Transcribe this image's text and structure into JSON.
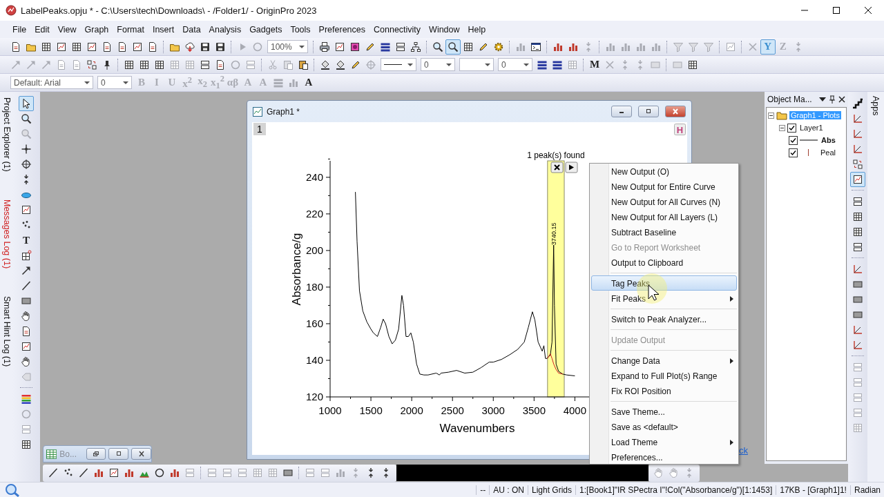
{
  "window": {
    "title": "LabelPeaks.opju * - C:\\Users\\tech\\Downloads\\ - /Folder1/ - OriginPro 2023"
  },
  "menu_bar": [
    "File",
    "Edit",
    "View",
    "Graph",
    "Format",
    "Insert",
    "Data",
    "Analysis",
    "Gadgets",
    "Tools",
    "Preferences",
    "Connectivity",
    "Window",
    "Help"
  ],
  "toolbars": [
    {
      "items": [
        {
          "kind": "icon",
          "disabled": false,
          "on": false
        },
        {
          "kind": "icon",
          "disabled": false,
          "on": false
        },
        {
          "kind": "icon",
          "disabled": false,
          "on": false
        },
        {
          "kind": "icon",
          "disabled": false,
          "on": false
        },
        {
          "kind": "icon",
          "disabled": false,
          "on": false
        },
        {
          "kind": "icon",
          "disabled": false,
          "on": false
        },
        {
          "kind": "icon",
          "disabled": false,
          "on": false
        },
        {
          "kind": "icon",
          "disabled": false,
          "on": false
        },
        {
          "kind": "icon",
          "disabled": false,
          "on": false
        },
        {
          "kind": "icon",
          "disabled": false,
          "on": false
        },
        {
          "kind": "separator"
        },
        {
          "kind": "icon",
          "disabled": false,
          "on": false
        },
        {
          "kind": "icon",
          "disabled": false,
          "on": false
        },
        {
          "kind": "icon",
          "disabled": false,
          "on": false
        },
        {
          "kind": "icon",
          "disabled": false,
          "on": false
        },
        {
          "kind": "separator"
        },
        {
          "kind": "icon",
          "disabled": true,
          "on": false
        },
        {
          "kind": "icon",
          "disabled": true,
          "on": false
        },
        {
          "kind": "combo",
          "value": "100%"
        },
        {
          "kind": "separator"
        },
        {
          "kind": "icon",
          "disabled": false,
          "on": false
        },
        {
          "kind": "icon",
          "disabled": false,
          "on": false
        },
        {
          "kind": "icon",
          "disabled": false,
          "on": false
        },
        {
          "kind": "icon",
          "disabled": false,
          "on": false
        },
        {
          "kind": "icon",
          "disabled": false,
          "on": false
        },
        {
          "kind": "icon",
          "disabled": false,
          "on": false
        },
        {
          "kind": "icon",
          "disabled": false,
          "on": false
        },
        {
          "kind": "separator"
        },
        {
          "kind": "icon",
          "disabled": false,
          "on": false
        },
        {
          "kind": "icon",
          "disabled": false,
          "on": true
        },
        {
          "kind": "icon",
          "disabled": false,
          "on": false
        },
        {
          "kind": "icon",
          "disabled": false,
          "on": false
        },
        {
          "kind": "icon",
          "disabled": false,
          "on": false
        },
        {
          "kind": "separator"
        },
        {
          "kind": "icon",
          "disabled": true,
          "on": false
        },
        {
          "kind": "icon",
          "disabled": false,
          "on": false
        },
        {
          "kind": "separator"
        },
        {
          "kind": "icon",
          "disabled": false,
          "on": false
        },
        {
          "kind": "icon",
          "disabled": false,
          "on": false
        },
        {
          "kind": "icon",
          "disabled": true,
          "on": false
        },
        {
          "kind": "separator"
        },
        {
          "kind": "icon",
          "disabled": true,
          "on": false
        },
        {
          "kind": "icon",
          "disabled": true,
          "on": false
        },
        {
          "kind": "icon",
          "disabled": true,
          "on": false
        },
        {
          "kind": "icon",
          "disabled": true,
          "on": false
        },
        {
          "kind": "separator"
        },
        {
          "kind": "icon",
          "disabled": true,
          "on": false
        },
        {
          "kind": "icon",
          "disabled": true,
          "on": false
        },
        {
          "kind": "icon",
          "disabled": true,
          "on": false
        },
        {
          "kind": "separator"
        },
        {
          "kind": "icon",
          "disabled": true,
          "on": false
        },
        {
          "kind": "separator"
        },
        {
          "kind": "icon",
          "disabled": true,
          "on": false
        },
        {
          "kind": "glyph",
          "text": "Y",
          "disabled": false,
          "on": true
        },
        {
          "kind": "glyph",
          "text": "Z",
          "disabled": true,
          "on": false
        },
        {
          "kind": "icon",
          "disabled": true,
          "on": false
        }
      ]
    },
    {
      "items": [
        {
          "kind": "icon",
          "disabled": true,
          "on": false
        },
        {
          "kind": "icon",
          "disabled": true,
          "on": false
        },
        {
          "kind": "icon",
          "disabled": true,
          "on": false
        },
        {
          "kind": "icon",
          "disabled": true,
          "on": false
        },
        {
          "kind": "icon",
          "disabled": true,
          "on": false
        },
        {
          "kind": "icon",
          "disabled": false,
          "on": false
        },
        {
          "kind": "icon",
          "disabled": false,
          "on": false
        },
        {
          "kind": "separator"
        },
        {
          "kind": "icon",
          "disabled": false,
          "on": false
        },
        {
          "kind": "icon",
          "disabled": false,
          "on": false
        },
        {
          "kind": "icon",
          "disabled": false,
          "on": false
        },
        {
          "kind": "icon",
          "disabled": true,
          "on": false
        },
        {
          "kind": "icon",
          "disabled": true,
          "on": false
        },
        {
          "kind": "icon",
          "disabled": false,
          "on": false
        },
        {
          "kind": "icon",
          "disabled": false,
          "on": false
        },
        {
          "kind": "icon",
          "disabled": true,
          "on": false
        },
        {
          "kind": "icon",
          "disabled": true,
          "on": false
        },
        {
          "kind": "separator"
        },
        {
          "kind": "icon",
          "disabled": true,
          "on": false
        },
        {
          "kind": "icon",
          "disabled": true,
          "on": false
        },
        {
          "kind": "icon",
          "disabled": false,
          "on": false
        },
        {
          "kind": "separator"
        },
        {
          "kind": "icon",
          "disabled": false,
          "on": false
        },
        {
          "kind": "icon",
          "disabled": false,
          "on": false
        },
        {
          "kind": "icon",
          "disabled": false,
          "on": false
        },
        {
          "kind": "icon",
          "disabled": true,
          "on": false
        },
        {
          "kind": "line-combo"
        },
        {
          "kind": "combo",
          "value": "0"
        },
        {
          "kind": "combo"
        },
        {
          "kind": "combo",
          "value": "0"
        },
        {
          "kind": "icon",
          "disabled": false,
          "on": false
        },
        {
          "kind": "icon",
          "disabled": false,
          "on": false
        },
        {
          "kind": "icon",
          "disabled": true,
          "on": false
        },
        {
          "kind": "separator"
        },
        {
          "kind": "glyph",
          "text": "M",
          "disabled": false,
          "on": false
        },
        {
          "kind": "icon",
          "disabled": true,
          "on": false
        },
        {
          "kind": "icon",
          "disabled": true,
          "on": false
        },
        {
          "kind": "icon",
          "disabled": true,
          "on": false
        },
        {
          "kind": "icon",
          "disabled": true,
          "on": false
        },
        {
          "kind": "separator"
        },
        {
          "kind": "icon",
          "disabled": true,
          "on": false
        },
        {
          "kind": "icon",
          "disabled": false,
          "on": false
        }
      ]
    },
    {
      "items": [
        {
          "kind": "font-combo",
          "value": "Default: Arial"
        },
        {
          "kind": "combo",
          "value": "0"
        },
        {
          "kind": "glyph",
          "text": "B",
          "disabled": true,
          "on": false
        },
        {
          "kind": "glyph",
          "text": "I",
          "disabled": true,
          "on": false
        },
        {
          "kind": "glyph",
          "text": "U",
          "disabled": true,
          "on": false
        },
        {
          "kind": "glyph",
          "text": "x$^{2}$",
          "disabled": true,
          "on": false
        },
        {
          "kind": "glyph",
          "text": "x$_{2}$",
          "disabled": true,
          "on": false
        },
        {
          "kind": "glyph",
          "text": "x$_{1}$$^{2}$",
          "disabled": true,
          "on": false
        },
        {
          "kind": "glyph",
          "text": "αβ",
          "disabled": true,
          "on": false
        },
        {
          "kind": "glyph",
          "text": "A",
          "disabled": true,
          "on": false
        },
        {
          "kind": "glyph",
          "text": "A",
          "disabled": true,
          "on": false
        },
        {
          "kind": "icon",
          "disabled": true,
          "on": false
        },
        {
          "kind": "icon",
          "disabled": true,
          "on": false
        },
        {
          "kind": "glyph",
          "text": "A",
          "disabled": false,
          "on": false
        }
      ]
    }
  ],
  "side_tabs": [
    {
      "label": "Project Explorer (1)",
      "alert": false
    },
    {
      "label": "Messages Log (1)",
      "alert": true
    },
    {
      "label": "Smart Hint Log (1)",
      "alert": false
    }
  ],
  "tools_toolbar": {
    "items": [
      {
        "kind": "icon",
        "disabled": false,
        "on": true
      },
      {
        "kind": "icon",
        "disabled": false,
        "on": false
      },
      {
        "kind": "icon",
        "disabled": true,
        "on": false
      },
      {
        "kind": "icon",
        "disabled": false,
        "on": false
      },
      {
        "kind": "icon",
        "disabled": false,
        "on": false
      },
      {
        "kind": "icon",
        "disabled": false,
        "on": false
      },
      {
        "kind": "icon",
        "disabled": false,
        "on": false
      },
      {
        "kind": "icon",
        "disabled": false,
        "on": false
      },
      {
        "kind": "icon",
        "disabled": false,
        "on": false
      },
      {
        "kind": "glyph",
        "text": "T",
        "disabled": false,
        "on": false
      },
      {
        "kind": "icon",
        "disabled": false,
        "on": false
      },
      {
        "kind": "icon",
        "disabled": false,
        "on": false
      },
      {
        "kind": "icon",
        "disabled": false,
        "on": false
      },
      {
        "kind": "icon",
        "disabled": false,
        "on": false
      },
      {
        "kind": "icon",
        "disabled": false,
        "on": false
      },
      {
        "kind": "icon",
        "disabled": false,
        "on": false
      },
      {
        "kind": "icon",
        "disabled": false,
        "on": false
      },
      {
        "kind": "icon",
        "disabled": false,
        "on": false
      },
      {
        "kind": "icon",
        "disabled": true,
        "on": false
      },
      {
        "kind": "separator"
      },
      {
        "kind": "icon",
        "disabled": false,
        "on": false
      },
      {
        "kind": "icon",
        "disabled": true,
        "on": false
      },
      {
        "kind": "icon",
        "disabled": true,
        "on": false
      },
      {
        "kind": "icon",
        "disabled": false,
        "on": false
      }
    ]
  },
  "graph_window": {
    "title": "Graph1 *",
    "layer_tab": "1",
    "hint_button": "H",
    "roi_status": "1 peak(s) found",
    "chart_data": {
      "type": "line",
      "xlabel": "Wavenumbers",
      "ylabel": "Absorbance/g",
      "xlim": [
        1000,
        4200
      ],
      "ylim": [
        120,
        249
      ],
      "xticks": [
        1000,
        1500,
        2000,
        2500,
        3000,
        3500,
        4000
      ],
      "yticks": [
        120,
        140,
        160,
        180,
        200,
        220,
        240
      ],
      "x": [
        1310,
        1330,
        1360,
        1400,
        1450,
        1500,
        1530,
        1580,
        1620,
        1650,
        1680,
        1720,
        1760,
        1800,
        1840,
        1880,
        1900,
        1930,
        1960,
        1990,
        2020,
        2060,
        2100,
        2150,
        2200,
        2300,
        2340,
        2360,
        2450,
        2550,
        2650,
        2750,
        2850,
        2950,
        3000,
        3100,
        3200,
        3300,
        3380,
        3430,
        3480,
        3510,
        3550,
        3600,
        3620,
        3640,
        3660,
        3700,
        3720,
        3740,
        3750,
        3770,
        3800,
        3850,
        3900,
        4000
      ],
      "series": [
        {
          "color": "#000000",
          "values": [
            232,
            205,
            178,
            167,
            161,
            157,
            155,
            153,
            158,
            162.5,
            160,
            153,
            149,
            151,
            157,
            175.5,
            170,
            153,
            153,
            155,
            150,
            138,
            132.5,
            132,
            132,
            133,
            132,
            133,
            133.5,
            134.5,
            133,
            133.5,
            136,
            139,
            139,
            140.5,
            143,
            146,
            150,
            158,
            166.5,
            162,
            150,
            145,
            148,
            141,
            141,
            143,
            150,
            203,
            170,
            138,
            134,
            132.5,
            132,
            131.5
          ]
        },
        {
          "color": "#d02020",
          "values": [
            null,
            null,
            null,
            null,
            null,
            null,
            null,
            null,
            null,
            null,
            null,
            null,
            null,
            null,
            null,
            null,
            null,
            null,
            null,
            null,
            null,
            null,
            null,
            null,
            null,
            null,
            null,
            null,
            null,
            null,
            null,
            null,
            null,
            null,
            null,
            null,
            null,
            null,
            null,
            null,
            null,
            null,
            null,
            null,
            null,
            null,
            141,
            143.5,
            141,
            138,
            137,
            135,
            133,
            132.5,
            null,
            null
          ]
        }
      ],
      "bands": [
        {
          "axis": "x",
          "from": 3665,
          "to": 3870
        }
      ],
      "annotations": [
        {
          "x": 3740,
          "y": 203,
          "text": "3740.15"
        }
      ]
    }
  },
  "minimized_window": {
    "title": "Bo..."
  },
  "workspace_link": "ck",
  "object_manager": {
    "title": "Object Ma...",
    "tree": [
      {
        "label": "Graph1 - Plots",
        "kind": "graph",
        "selected": true,
        "expanded": true,
        "children": [
          {
            "label": "Layer1",
            "selected": false,
            "expanded": true,
            "checked": true,
            "children": [
              {
                "label": "Abs",
                "kind": "line-plot",
                "selected": false,
                "checked": true,
                "active": true
              },
              {
                "label": "Peal",
                "kind": "drop-plot",
                "selected": false,
                "checked": true,
                "active": false
              }
            ]
          }
        ]
      }
    ]
  },
  "right_toolbar": {
    "items": [
      {
        "kind": "icon",
        "disabled": false,
        "on": false
      },
      {
        "kind": "icon",
        "disabled": false,
        "on": false
      },
      {
        "kind": "icon",
        "disabled": false,
        "on": false
      },
      {
        "kind": "icon",
        "disabled": false,
        "on": false
      },
      {
        "kind": "icon",
        "disabled": false,
        "on": false
      },
      {
        "kind": "icon",
        "disabled": false,
        "on": true
      },
      {
        "kind": "separator"
      },
      {
        "kind": "icon",
        "disabled": false,
        "on": false
      },
      {
        "kind": "icon",
        "disabled": false,
        "on": false
      },
      {
        "kind": "icon",
        "disabled": false,
        "on": false
      },
      {
        "kind": "icon",
        "disabled": false,
        "on": false
      },
      {
        "kind": "separator"
      },
      {
        "kind": "icon",
        "disabled": false,
        "on": false
      },
      {
        "kind": "icon",
        "disabled": false,
        "on": false
      },
      {
        "kind": "icon",
        "disabled": false,
        "on": false
      },
      {
        "kind": "icon",
        "disabled": false,
        "on": false
      },
      {
        "kind": "icon",
        "disabled": false,
        "on": false
      },
      {
        "kind": "icon",
        "disabled": false,
        "on": false
      },
      {
        "kind": "separator"
      },
      {
        "kind": "icon",
        "disabled": true,
        "on": false
      },
      {
        "kind": "icon",
        "disabled": true,
        "on": false
      },
      {
        "kind": "icon",
        "disabled": true,
        "on": false
      },
      {
        "kind": "icon",
        "disabled": true,
        "on": false
      },
      {
        "kind": "icon",
        "disabled": true,
        "on": false
      }
    ]
  },
  "apps_tab": "Apps",
  "bottom_toolbars": [
    {
      "items": [
        {
          "kind": "icon",
          "disabled": false,
          "on": false
        },
        {
          "kind": "icon",
          "disabled": false,
          "on": false
        },
        {
          "kind": "icon",
          "disabled": false,
          "on": false
        },
        {
          "kind": "icon",
          "disabled": false,
          "on": false
        },
        {
          "kind": "icon",
          "disabled": false,
          "on": false
        },
        {
          "kind": "icon",
          "disabled": false,
          "on": false
        },
        {
          "kind": "icon",
          "disabled": false,
          "on": false
        },
        {
          "kind": "icon",
          "disabled": false,
          "on": false
        },
        {
          "kind": "icon",
          "disabled": false,
          "on": false
        },
        {
          "kind": "icon",
          "disabled": true,
          "on": false
        },
        {
          "kind": "separator"
        },
        {
          "kind": "icon",
          "disabled": true,
          "on": false
        },
        {
          "kind": "icon",
          "disabled": true,
          "on": false
        },
        {
          "kind": "icon",
          "disabled": true,
          "on": false
        },
        {
          "kind": "icon",
          "disabled": true,
          "on": false
        },
        {
          "kind": "icon",
          "disabled": true,
          "on": false
        },
        {
          "kind": "icon",
          "disabled": false,
          "on": false
        },
        {
          "kind": "separator"
        },
        {
          "kind": "icon",
          "disabled": true,
          "on": false
        },
        {
          "kind": "icon",
          "disabled": true,
          "on": false
        },
        {
          "kind": "icon",
          "disabled": true,
          "on": false
        },
        {
          "kind": "icon",
          "disabled": true,
          "on": false
        },
        {
          "kind": "icon",
          "disabled": false,
          "on": false
        },
        {
          "kind": "icon",
          "disabled": false,
          "on": false
        }
      ]
    },
    {
      "items": [
        {
          "kind": "icon",
          "disabled": true,
          "on": false
        },
        {
          "kind": "icon",
          "disabled": true,
          "on": false
        },
        {
          "kind": "icon",
          "disabled": true,
          "on": false
        }
      ]
    }
  ],
  "context_menu": {
    "items": [
      {
        "kind": "item",
        "label": "New Output (O)",
        "selected": false,
        "disabled": false,
        "submenu": false
      },
      {
        "kind": "item",
        "label": "New Output for Entire Curve",
        "selected": false,
        "disabled": false,
        "submenu": false
      },
      {
        "kind": "item",
        "label": "New Output for All Curves (N)",
        "selected": false,
        "disabled": false,
        "submenu": false
      },
      {
        "kind": "item",
        "label": "New Output for All Layers (L)",
        "selected": false,
        "disabled": false,
        "submenu": false
      },
      {
        "kind": "item",
        "label": "Subtract Baseline",
        "selected": false,
        "disabled": false,
        "submenu": false
      },
      {
        "kind": "item",
        "label": "Go to Report Worksheet",
        "selected": false,
        "disabled": true,
        "submenu": false
      },
      {
        "kind": "item",
        "label": "Output to Clipboard",
        "selected": false,
        "disabled": false,
        "submenu": false
      },
      {
        "kind": "separator"
      },
      {
        "kind": "item",
        "label": "Tag Peaks",
        "selected": true,
        "disabled": false,
        "submenu": false
      },
      {
        "kind": "item",
        "label": "Fit Peaks",
        "selected": false,
        "disabled": false,
        "submenu": true
      },
      {
        "kind": "separator"
      },
      {
        "kind": "item",
        "label": "Switch to Peak Analyzer...",
        "selected": false,
        "disabled": false,
        "submenu": false
      },
      {
        "kind": "separator"
      },
      {
        "kind": "item",
        "label": "Update Output",
        "selected": false,
        "disabled": true,
        "submenu": false
      },
      {
        "kind": "separator"
      },
      {
        "kind": "item",
        "label": "Change Data",
        "selected": false,
        "disabled": false,
        "submenu": true
      },
      {
        "kind": "item",
        "label": "Expand to Full Plot(s) Range",
        "selected": false,
        "disabled": false,
        "submenu": false
      },
      {
        "kind": "item",
        "label": "Fix ROI Position",
        "selected": false,
        "disabled": false,
        "submenu": false
      },
      {
        "kind": "separator"
      },
      {
        "kind": "item",
        "label": "Save Theme...",
        "selected": false,
        "disabled": false,
        "submenu": false
      },
      {
        "kind": "item",
        "label": "Save as <default>",
        "selected": false,
        "disabled": false,
        "submenu": false
      },
      {
        "kind": "item",
        "label": "Load Theme",
        "selected": false,
        "disabled": false,
        "submenu": true
      },
      {
        "kind": "item",
        "label": "Preferences...",
        "selected": false,
        "disabled": false,
        "submenu": false
      }
    ]
  },
  "status_bar": [
    "--",
    "AU : ON",
    "Light Grids",
    "1:[Book1]\"IR SPectra I\"!Col(\"Absorbance/g\")[1:1453]",
    "17KB - [Graph1]1!",
    "Radian"
  ]
}
